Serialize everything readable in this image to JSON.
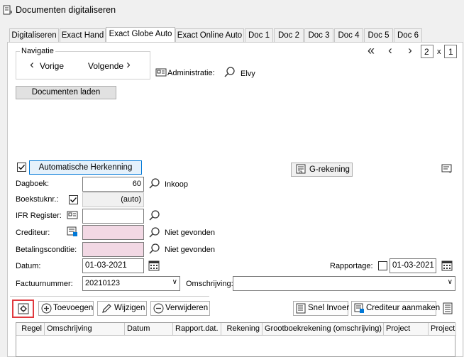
{
  "window": {
    "title": "Documenten digitaliseren"
  },
  "tabs": [
    {
      "label": "Digitaliseren"
    },
    {
      "label": "Exact Hand"
    },
    {
      "label": "Exact Globe Auto"
    },
    {
      "label": "Exact Online Auto"
    },
    {
      "label": "Doc 1"
    },
    {
      "label": "Doc 2"
    },
    {
      "label": "Doc 3"
    },
    {
      "label": "Doc 4"
    },
    {
      "label": "Doc 5"
    },
    {
      "label": "Doc 6"
    }
  ],
  "pager": {
    "current": "2",
    "sep": "x",
    "total": "1"
  },
  "navigatie": {
    "legend": "Navigatie",
    "prev": "Vorige",
    "next": "Volgende"
  },
  "administratie": {
    "label": "Administratie:",
    "value": "Elvy"
  },
  "load_button": "Documenten laden",
  "auto_recognition": {
    "label": "Automatische Herkenning",
    "checked": true
  },
  "grekening_button": "G-rekening",
  "form": {
    "dagboek": {
      "label": "Dagboek:",
      "value": "60",
      "desc": "Inkoop"
    },
    "boekstuknr": {
      "label": "Boekstuknr.:",
      "value": "(auto)"
    },
    "ifr": {
      "label": "IFR Register:",
      "value": ""
    },
    "crediteur": {
      "label": "Crediteur:",
      "value": "",
      "desc": "Niet gevonden"
    },
    "betalingsconditie": {
      "label": "Betalingsconditie:",
      "value": "",
      "desc": "Niet gevonden"
    },
    "datum": {
      "label": "Datum:",
      "value": "01-03-2021"
    },
    "rapportage": {
      "label": "Rapportage:",
      "value": "01-03-2021"
    },
    "factuurnummer": {
      "label": "Factuurnummer:",
      "value": "20210123"
    },
    "omschrijving": {
      "label": "Omschrijving:",
      "value": ""
    }
  },
  "toolbar": {
    "add": "Toevoegen",
    "edit": "Wijzigen",
    "delete": "Verwijderen",
    "quick": "Snel Invoer",
    "create_creditor": "Crediteur aanmaken"
  },
  "grid": {
    "columns": [
      "Regel",
      "Omschrijving",
      "Datum",
      "Rapport.dat.",
      "Rekening",
      "Grootboekrekening (omschrijving)",
      "Project",
      "Project ("
    ]
  },
  "colors": {
    "pink": "#f2d8e4",
    "accent": "#0078d7",
    "highlight": "#e0393e"
  }
}
